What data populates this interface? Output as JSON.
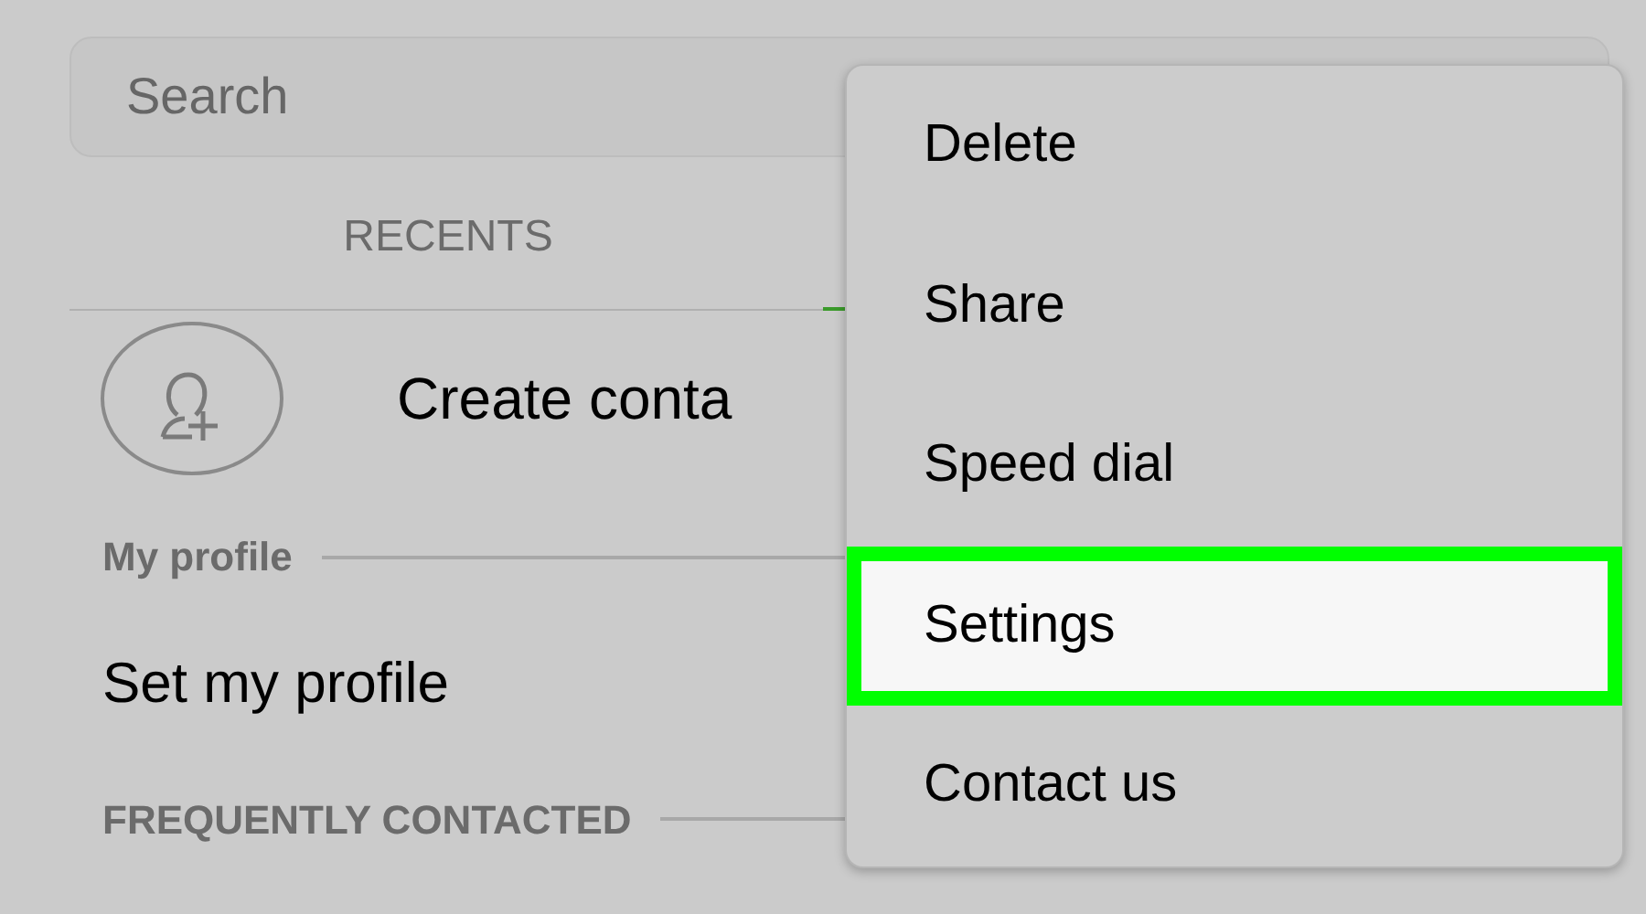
{
  "search": {
    "placeholder": "Search"
  },
  "tabs": [
    {
      "label": "RECENTS",
      "selected": false
    }
  ],
  "create_contact": {
    "label": "Create conta"
  },
  "sections": [
    {
      "header": "My profile",
      "items": [
        "Set my profile"
      ]
    },
    {
      "header": "FREQUENTLY CONTACTED"
    }
  ],
  "menu": {
    "items": [
      {
        "label": "Delete",
        "selected": false
      },
      {
        "label": "Share",
        "selected": false
      },
      {
        "label": "Speed dial",
        "selected": false
      },
      {
        "label": "Settings",
        "selected": true
      },
      {
        "label": "Contact us",
        "selected": false
      }
    ]
  }
}
